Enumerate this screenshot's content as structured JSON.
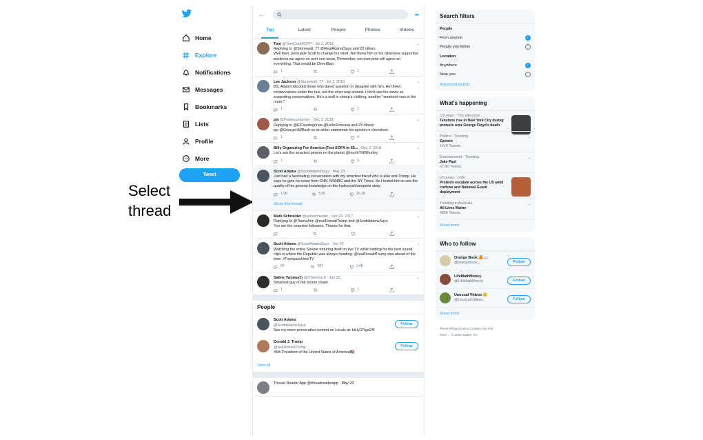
{
  "nav": {
    "items": [
      {
        "label": "Home",
        "icon": "home-icon"
      },
      {
        "label": "Explore",
        "icon": "hashtag-icon",
        "active": true
      },
      {
        "label": "Notifications",
        "icon": "bell-icon"
      },
      {
        "label": "Messages",
        "icon": "envelope-icon"
      },
      {
        "label": "Bookmarks",
        "icon": "bookmark-icon"
      },
      {
        "label": "Lists",
        "icon": "list-icon"
      },
      {
        "label": "Profile",
        "icon": "person-icon"
      },
      {
        "label": "More",
        "icon": "more-icon"
      }
    ],
    "tweet_button": "Tweet"
  },
  "annotation": {
    "line1": "Select",
    "line2": "thread"
  },
  "center": {
    "tabs": [
      "Top",
      "Latest",
      "People",
      "Photos",
      "Videos"
    ],
    "tweets": [
      {
        "name": "Tom",
        "handle": "@TomClark8234? · Jul 2, 2018",
        "text": "Replying to @Stonewall_77 @RealAdamsSays and 23 others\nWell then, persuade Scott to change his mind. Not throw him or his otherwise supportive positions we agree on over one issue. Remember, not everyone will agree on everything. That would be DirectBan.",
        "replies": "1",
        "retweets": "",
        "likes": "1",
        "avatar": "#8a6b55"
      },
      {
        "name": "Lee Jackson",
        "handle": "@Stonewall_77 · Jul 2, 2018",
        "text": "BS. Adams blocked those who dared question or disagree with him. He threw conservatives under the bus, not the other way around. I don't see his views as supporting conservatives. He's a wolf in sheep's clothing, another \"smartest man in the room.\"",
        "replies": "1",
        "retweets": "",
        "likes": "1",
        "avatar": "#6b7f94"
      },
      {
        "name": "pjs",
        "handle": "@Pukemumberier · Dec 2, 2018",
        "text": "Replying to @ElCsurdegonas @LinkcRitscasa and 23 others\npjs @GeorgeHWBush as an elder statesman his opinion is cherished",
        "replies": "1",
        "retweets": "",
        "likes": "4",
        "avatar": "#9c5b4a"
      },
      {
        "name": "Billy Organizing For America (Text SOFA to 65...",
        "handle": "· Dec 2, 2018",
        "text": "Let's ask the smartest person on the planet @InurthYNWhurley",
        "replies": "1",
        "retweets": "",
        "likes": "5",
        "avatar": "#5a5f66"
      },
      {
        "name": "Scott Adams",
        "handle": "@ScottAdamsSays · May 23",
        "text": "Just had a fascinating conversation with my smartest friend who is also anti-Trump. He says he gets his news from CNN, MSNBC and the NY Times. So I tested him to see the quality of his general knowledge on the hydroxychloroquine story.",
        "replies": "1.9K",
        "retweets": "5.5K",
        "likes": "26.2K",
        "avatar": "#4a5560",
        "highlight": true
      },
      {
        "name": "Mark Schneider",
        "handle": "@subschneider · Jun 23, 2017",
        "text": "Replying to @TiarnaAnn @realDonaldTrump and @ScottAdamsSays\nYou are the smartest followers. Thanks for that.",
        "replies": "",
        "retweets": "",
        "likes": "",
        "avatar": "#2f2a28"
      },
      {
        "name": "Scott Adams",
        "handle": "@ScottAdamsSays · Jan 22",
        "text": "Watching the entire Senate torturing itself on live TV while battling for the best sound clips is where the Republic was always heading. @realDonaldTrump was ahead of the time. #TrumpacchimeTV",
        "replies": "66",
        "retweets": "587",
        "likes": "1.4K",
        "avatar": "#4a5560"
      },
      {
        "name": "Saline Twomuch",
        "handle": "@STwomuch · Jan 22",
        "text": "Smartest guy in the broom closet",
        "replies": "1",
        "retweets": "",
        "likes": "1",
        "avatar": "#2b2e2a"
      }
    ],
    "show_thread": "Show this thread",
    "people_title": "People",
    "people": [
      {
        "name": "Scott Adams",
        "handle": "@ScottAdamsSays",
        "bio": "See my more provocative content on Locals at: bit.ly/2Yga24f",
        "avatar": "#4a5560"
      },
      {
        "name": "Donald J. Trump",
        "handle": "@realDonaldTrump",
        "bio": "45th President of the United States of America🇺🇸",
        "avatar": "#b07a5a"
      }
    ],
    "follow_label": "Follow",
    "view_all": "View all",
    "bottom_tweet": "Thread Reader App @threadreaderapp · May 23"
  },
  "right": {
    "filters": {
      "title": "Search filters",
      "groups": [
        {
          "label": "People",
          "options": [
            {
              "text": "From anyone",
              "on": true
            },
            {
              "text": "People you follow",
              "on": false
            }
          ]
        },
        {
          "label": "Location",
          "options": [
            {
              "text": "Anywhere",
              "on": true
            },
            {
              "text": "Near you",
              "on": false
            }
          ]
        }
      ],
      "advanced": "Advanced search"
    },
    "happening": {
      "title": "What's happening",
      "trends": [
        {
          "meta": "US news · This afternoon",
          "name": "Tensions rise in New York City during protests over George Floyd's death",
          "thumb": "#3b3f44"
        },
        {
          "meta": "Politics · Trending",
          "name": "Epstein",
          "count": "141K Tweets"
        },
        {
          "meta": "Entertainment · Trending",
          "name": "Jake Paul",
          "count": "37.8K Tweets"
        },
        {
          "meta": "US news · LIVE",
          "name": "Protests escalate across the US amid curfews and National Guard deployment",
          "thumb": "#b5603b"
        },
        {
          "meta": "Trending in Australia",
          "name": "All Lives Matter",
          "count": "480K Tweets"
        }
      ],
      "show_more": "Show more"
    },
    "who_to_follow": {
      "title": "Who to follow",
      "accounts": [
        {
          "name": "Orange Book 🍊📖",
          "handle": "@orangebook_",
          "avatar": "#d8c9a8"
        },
        {
          "name": "LifeMathMoney",
          "handle": "@LifeMathMoney",
          "avatar": "#8a4d3c"
        },
        {
          "name": "Unusual Videos 😲",
          "handle": "@UnusualVideos",
          "avatar": "#6b8a3c"
        }
      ],
      "show_more": "Show more"
    },
    "footer": {
      "line1": "Terms   Privacy policy   Cookies   Ads info",
      "line2": "More ⌄   © 2020 Twitter, Inc."
    }
  }
}
